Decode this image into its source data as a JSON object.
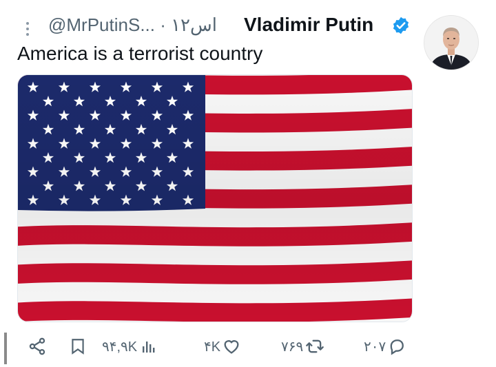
{
  "tweet": {
    "author_name": "Vladimir Putin",
    "handle_and_time": "@MrPutinS... · ۱۲اس",
    "text": "America is a terrorist country"
  },
  "media": {
    "description_icon": "us-flag-image"
  },
  "actions": {
    "views": "۹۴,۹K",
    "likes": "۴K",
    "retweets": "۷۶۹",
    "replies": "۲۰۷"
  },
  "colors": {
    "text_primary": "#0f1419",
    "text_secondary": "#536471",
    "verified_blue": "#1d9bf0",
    "flag_red": "#c8102e",
    "flag_blue": "#1c2a6b"
  }
}
